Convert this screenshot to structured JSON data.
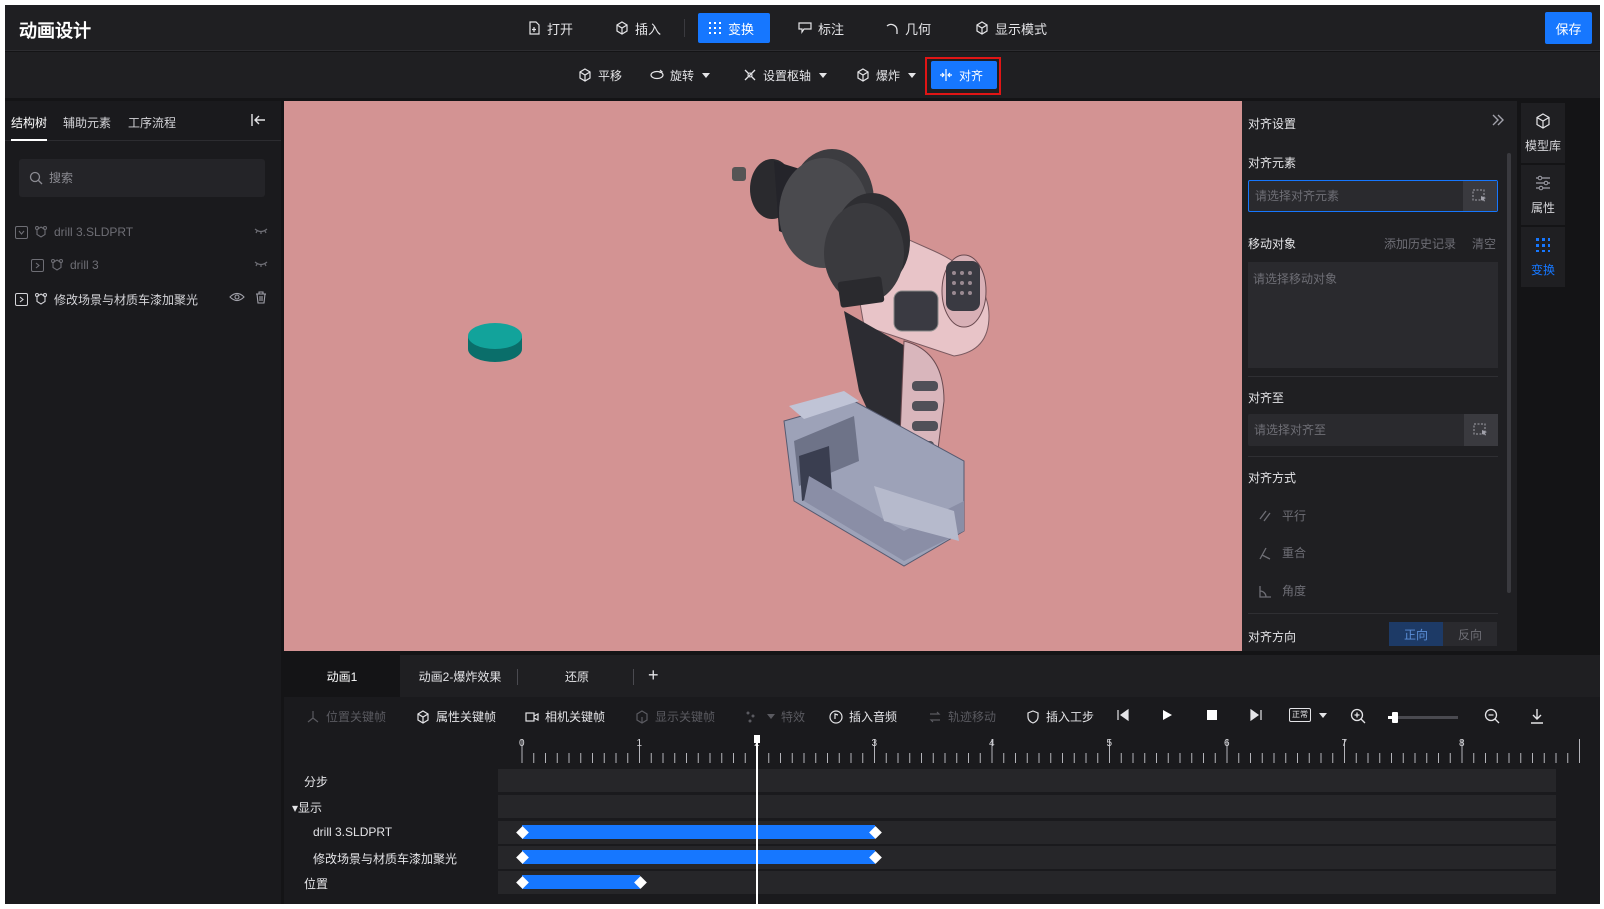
{
  "app": {
    "title": "动画设计",
    "save_label": "保存"
  },
  "toolbar": {
    "open": "打开",
    "insert": "插入",
    "transform": "变换",
    "annotate": "标注",
    "geometry": "几何",
    "display_mode": "显示模式"
  },
  "subtoolbar": {
    "translate": "平移",
    "rotate": "旋转",
    "pivot": "设置枢轴",
    "explode": "爆炸",
    "align": "对齐"
  },
  "left_panel": {
    "tabs": [
      "结构树",
      "辅助元素",
      "工序流程"
    ],
    "search_placeholder": "搜索",
    "tree": [
      {
        "label": "drill 3.SLDPRT"
      },
      {
        "label": "drill 3"
      },
      {
        "label": "修改场景与材质车漆加聚光"
      }
    ]
  },
  "align_panel": {
    "title": "对齐设置",
    "align_element_label": "对齐元素",
    "align_element_placeholder": "请选择对齐元素",
    "move_object_label": "移动对象",
    "add_history": "添加历史记录",
    "clear": "清空",
    "move_object_placeholder": "请选择移动对象",
    "align_to_label": "对齐至",
    "align_to_placeholder": "请选择对齐至",
    "method_label": "对齐方式",
    "methods": [
      "平行",
      "重合",
      "角度"
    ],
    "direction_label": "对齐方向",
    "direction_forward": "正向",
    "direction_reverse": "反向"
  },
  "right_strip": {
    "model_library": "模型库",
    "properties": "属性",
    "transform": "变换"
  },
  "timeline": {
    "tabs": [
      "动画1",
      "动画2-爆炸效果",
      "还原"
    ],
    "tools": {
      "position_keyframe": "位置关键帧",
      "property_keyframe": "属性关键帧",
      "camera_keyframe": "相机关键帧",
      "display_keyframe": "显示关键帧",
      "effects": "特效",
      "insert_audio": "插入音频",
      "trajectory_move": "轨迹移动",
      "insert_step": "插入工步"
    },
    "speed_badge": "正常",
    "zoom_level": 0.1,
    "ruler_labels": [
      "0",
      "1",
      "2",
      "3",
      "4",
      "5",
      "6",
      "7",
      "8"
    ],
    "playhead_time": 2,
    "tracks": [
      {
        "label": "分步"
      },
      {
        "label": "▾显示"
      },
      {
        "label": "drill 3.SLDPRT",
        "start": 0,
        "end": 3
      },
      {
        "label": "修改场景与材质车漆加聚光",
        "start": 0,
        "end": 3
      },
      {
        "label": "位置",
        "start": 0,
        "end": 1
      }
    ]
  },
  "colors": {
    "accent": "#1677ff",
    "viewport_bg": "#d39393",
    "highlight": "#e01515"
  }
}
